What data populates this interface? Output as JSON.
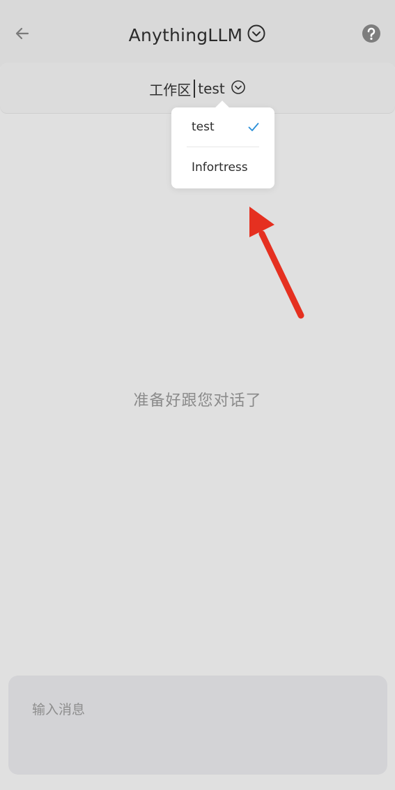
{
  "header": {
    "back_icon": "arrow-left-icon",
    "title": "AnythingLLM",
    "title_dropdown_icon": "chevron-down-circle-icon",
    "help_icon": "question-circle-icon"
  },
  "workspace": {
    "label": "工作区",
    "current": "test",
    "dropdown_icon": "chevron-down-circle-icon"
  },
  "dropdown": {
    "items": [
      {
        "label": "test",
        "selected": true
      },
      {
        "label": "Infortress",
        "selected": false
      }
    ],
    "check_color": "#2a8fd8"
  },
  "annotation": {
    "arrow_color": "#e53020"
  },
  "main": {
    "empty_message": "准备好跟您对话了"
  },
  "composer": {
    "placeholder": "输入消息"
  }
}
